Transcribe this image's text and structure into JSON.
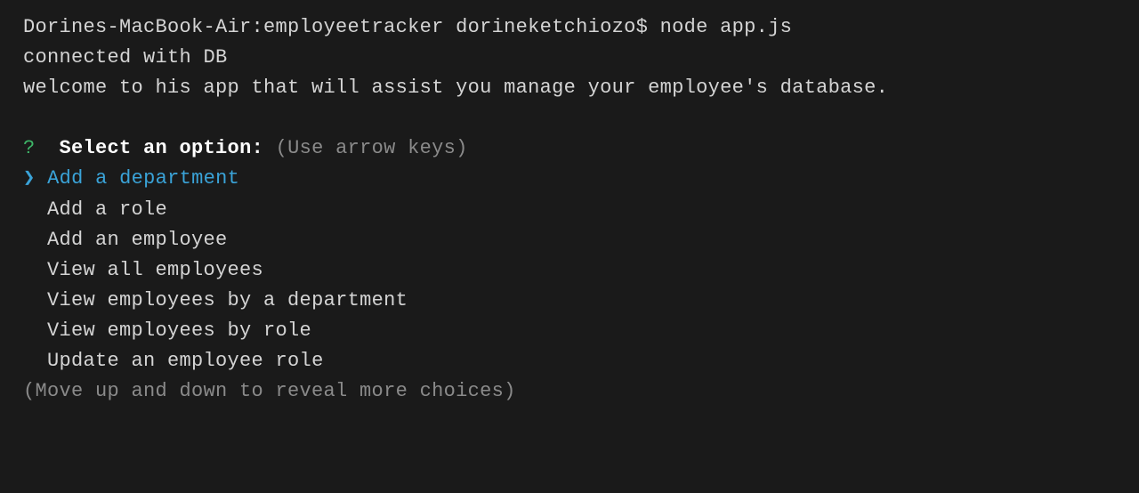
{
  "terminal": {
    "command_line": "Dorines-MacBook-Air:employeetracker dorineketchiozo$ node app.js",
    "output1": "connected with DB",
    "output2": "welcome to his app that will assist you manage your employee's database."
  },
  "inquirer": {
    "question_mark": "?",
    "prompt_label": "Select an option:",
    "prompt_hint": "(Use arrow keys)",
    "pointer": "❯",
    "options": [
      {
        "label": "Add a department",
        "selected": true
      },
      {
        "label": "Add a role",
        "selected": false
      },
      {
        "label": "Add an employee",
        "selected": false
      },
      {
        "label": "View all employees",
        "selected": false
      },
      {
        "label": "View employees by a department",
        "selected": false
      },
      {
        "label": "View employees by role",
        "selected": false
      },
      {
        "label": "Update an employee role",
        "selected": false
      }
    ],
    "footer_hint": "(Move up and down to reveal more choices)"
  },
  "colors": {
    "background": "#1a1a1a",
    "text": "#d4d4d4",
    "green": "#3eb668",
    "cyan": "#3aa3d8",
    "gray": "#8a8a8a",
    "white": "#ffffff"
  }
}
